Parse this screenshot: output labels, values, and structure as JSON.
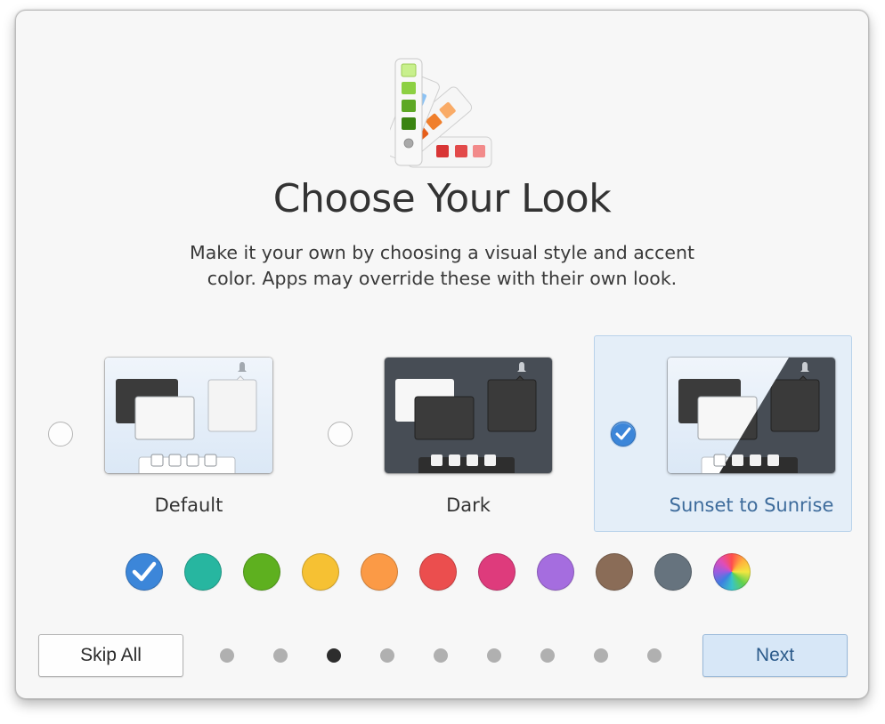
{
  "dialog": {
    "title": "Choose Your Look",
    "description_line1": "Make it your own by choosing a visual style and accent",
    "description_line2": "color. Apps may override these with their own look.",
    "hero_icon": "color-palette-swatches-icon"
  },
  "styles": [
    {
      "label": "Default",
      "selected": false
    },
    {
      "label": "Dark",
      "selected": false
    },
    {
      "label": "Sunset to Sunrise",
      "selected": true
    }
  ],
  "accent_colors": [
    {
      "name": "blue",
      "hex": "#3c86d9",
      "selected": true
    },
    {
      "name": "teal",
      "hex": "#27b6a0",
      "selected": false
    },
    {
      "name": "green",
      "hex": "#5eb01f",
      "selected": false
    },
    {
      "name": "yellow",
      "hex": "#f6c133",
      "selected": false
    },
    {
      "name": "orange",
      "hex": "#fb9a46",
      "selected": false
    },
    {
      "name": "red",
      "hex": "#eb4e4e",
      "selected": false
    },
    {
      "name": "pink",
      "hex": "#de3b7c",
      "selected": false
    },
    {
      "name": "purple",
      "hex": "#a56ddf",
      "selected": false
    },
    {
      "name": "brown",
      "hex": "#8a6c57",
      "selected": false
    },
    {
      "name": "slate",
      "hex": "#66737e",
      "selected": false
    },
    {
      "name": "multicolor",
      "hex": "conic",
      "selected": false
    }
  ],
  "footer": {
    "skip_label": "Skip All",
    "next_label": "Next",
    "page_count": 9,
    "current_page": 3
  }
}
